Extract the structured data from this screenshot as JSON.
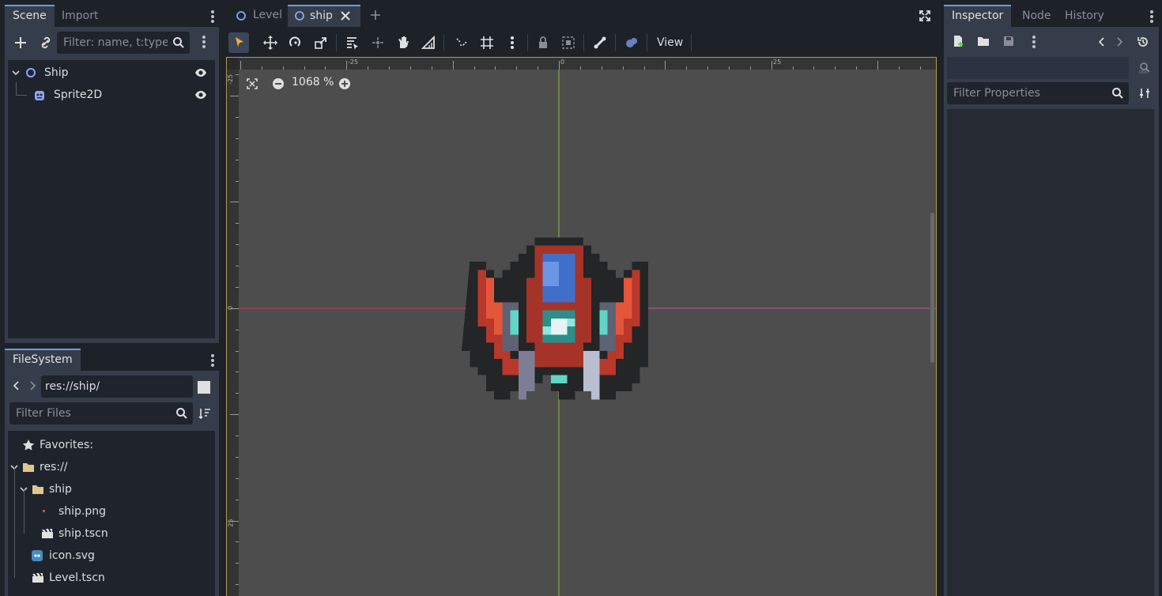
{
  "left_dock": {
    "scene_panel": {
      "tabs": [
        "Scene",
        "Import"
      ],
      "active_tab": 0,
      "filter_placeholder": "Filter: name, t:type,",
      "nodes": [
        {
          "label": "Ship",
          "icon": "node2d-icon",
          "visible": true
        },
        {
          "label": "Sprite2D",
          "icon": "sprite2d-icon",
          "visible": true
        }
      ]
    },
    "filesystem_panel": {
      "title": "FileSystem",
      "path": "res://ship/",
      "filter_placeholder": "Filter Files",
      "items": [
        {
          "label": "Favorites:",
          "icon": "star-icon"
        },
        {
          "label": "res://",
          "icon": "folder-icon"
        },
        {
          "label": "ship",
          "icon": "folder-icon"
        },
        {
          "label": "ship.png",
          "icon": "image-file-icon"
        },
        {
          "label": "ship.tscn",
          "icon": "scene-file-icon"
        },
        {
          "label": "icon.svg",
          "icon": "godot-icon"
        },
        {
          "label": "Level.tscn",
          "icon": "scene-file-icon"
        }
      ]
    }
  },
  "editor": {
    "scene_tabs": [
      {
        "label": "Level",
        "active": false
      },
      {
        "label": "ship",
        "active": true
      }
    ],
    "toolbar": {
      "view_label": "View"
    },
    "viewport": {
      "zoom_label": "1068 %",
      "ruler_h_labels": [
        "-25",
        "0",
        "25"
      ],
      "ruler_v_labels": [
        "-25",
        "0",
        "25"
      ]
    }
  },
  "right_dock": {
    "tabs": [
      "Inspector",
      "Node",
      "History"
    ],
    "active_tab": 0,
    "filter_placeholder": "Filter Properties"
  },
  "colors": {
    "accent": "#699ce8",
    "viewport_border": "#b69848",
    "axis_x": "#d7334a",
    "axis_y": "#9bd33a"
  }
}
